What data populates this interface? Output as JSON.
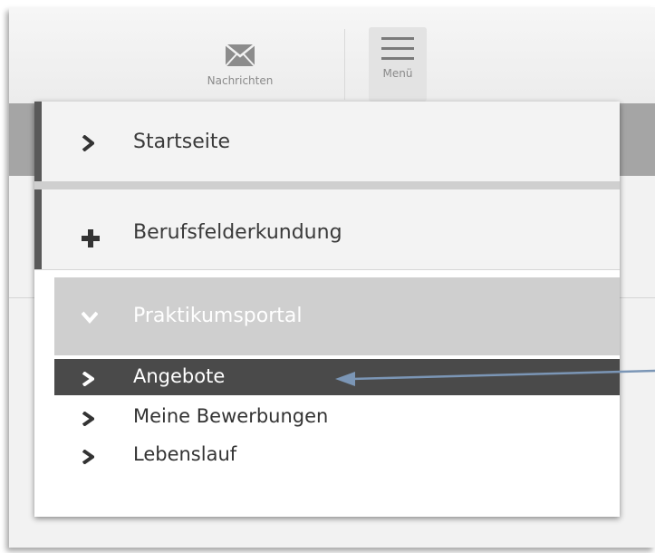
{
  "header": {
    "messages_label": "Nachrichten",
    "menu_label": "Menü"
  },
  "menu": {
    "items": [
      {
        "label": "Startseite",
        "icon": "chevron-right-icon"
      },
      {
        "label": "Berufsfelderkundung",
        "icon": "plus-icon"
      },
      {
        "label": "Praktikumsportal",
        "icon": "chevron-down-icon",
        "expanded": true
      }
    ],
    "subitems": [
      {
        "label": "Angebote",
        "icon": "chevron-right-icon",
        "active": true
      },
      {
        "label": "Meine Bewerbungen",
        "icon": "chevron-right-icon"
      },
      {
        "label": "Lebenslauf",
        "icon": "chevron-right-icon"
      }
    ]
  },
  "colors": {
    "active_item_bg": "#4a4a4a",
    "expanded_header_bg": "#cfcfcf",
    "item_bar": "#595959",
    "annotation_arrow": "#7b96b6"
  }
}
